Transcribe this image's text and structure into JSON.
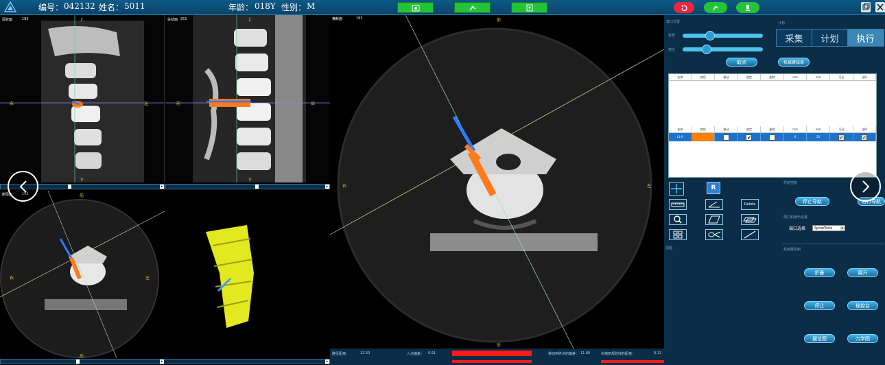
{
  "header": {
    "id_label": "编号：",
    "id_value": "042132",
    "name_label": "姓名：",
    "name_value": "5011",
    "age_label": "年龄：",
    "age_value": "018Y",
    "sex_label": "性别：",
    "sex_value": "M",
    "toolbar_icons": [
      "patient-icon",
      "robot-arm-icon",
      "export-icon"
    ],
    "right_icons": [
      "undo-icon",
      "arm-up-icon",
      "light-icon"
    ],
    "window_icons": [
      "restore-icon",
      "close-icon"
    ]
  },
  "views": {
    "coronal": {
      "title": "冠状面",
      "slice": "193",
      "top": "上",
      "bottom": "下",
      "left": "右",
      "right": "左"
    },
    "sagittal": {
      "title": "矢状面",
      "slice": "251",
      "top": "上",
      "bottom": "下",
      "left": "前",
      "right": "后"
    },
    "axial_small": {
      "title": "断层面",
      "slice": "193",
      "top": "前",
      "bottom": "后",
      "left": "右",
      "right": "左"
    },
    "axial_large": {
      "title": "横断面",
      "slice": "193",
      "top": "前",
      "bottom": "后",
      "left": "右",
      "right": "左"
    }
  },
  "window": {
    "section_title": "窗口位置",
    "width_label": "窗宽",
    "level_label": "窗位",
    "width_value": 0.32,
    "level_value": 0.27,
    "pick_button": "取点"
  },
  "tabs": {
    "caption": "计划",
    "items": [
      "采集",
      "计划",
      "执行"
    ],
    "active": 2
  },
  "arm_end_button": "机械臂结束",
  "table": {
    "headers": [
      "名称",
      "颜色",
      "移动",
      "锁定",
      "删除",
      "mm",
      "mm",
      "可见",
      "注释"
    ],
    "headers2": [
      "名称",
      "颜色",
      "移动",
      "锁定",
      "删除",
      "mm",
      "mm",
      "可见",
      "注释"
    ],
    "row": {
      "name": "L1-R",
      "color": "#ff8000",
      "move": false,
      "lock": true,
      "delete": false,
      "v1": "6",
      "v2": "25",
      "visible": true,
      "note": true
    }
  },
  "tools": [
    {
      "icon": "measure-ruler-icon",
      "label": ""
    },
    {
      "icon": "angle-icon",
      "label": ""
    },
    {
      "icon": "delete-icon",
      "label": "Delete"
    },
    {
      "icon": "magnify-icon",
      "label": ""
    },
    {
      "icon": "parallelogram-icon",
      "label": ""
    },
    {
      "icon": "layers-icon",
      "label": ""
    },
    {
      "icon": "grid-icon",
      "label": ""
    },
    {
      "icon": "eye-trajectory-icon",
      "label": ""
    },
    {
      "icon": "line-icon",
      "label": ""
    }
  ],
  "crosshair_icon": "crosshair-icon",
  "reset_button": "R",
  "nav": {
    "section_title": "导航控制",
    "stop_label": "停止导航",
    "start_label": "进行导航",
    "port_section": "端口和通讯设置",
    "port_label": "端口选择",
    "port_value": "SpineTools"
  },
  "arm": {
    "section_title": "机械臂控制",
    "buttons": [
      "折叠",
      "展开",
      "停止",
      "操控台",
      "摆位图",
      "力学图"
    ]
  },
  "view_section": "视图",
  "status": {
    "path_distance_label": "路径距离：",
    "path_distance_value": "12.50",
    "entry_offset_label": "入点偏差：",
    "entry_offset_value": "0.91",
    "end_offset_label": "移动到终点的偏差：",
    "end_offset_value": "11.60",
    "tip_distance_label": "尖端到规划线的距离：",
    "tip_distance_value": "0.12"
  },
  "colors": {
    "accent": "#2a9bd6",
    "header": "#0e5a87",
    "green": "#25c23a",
    "red": "#e8283c",
    "implant": "#ff7a1a",
    "probe": "#2f7bff"
  }
}
